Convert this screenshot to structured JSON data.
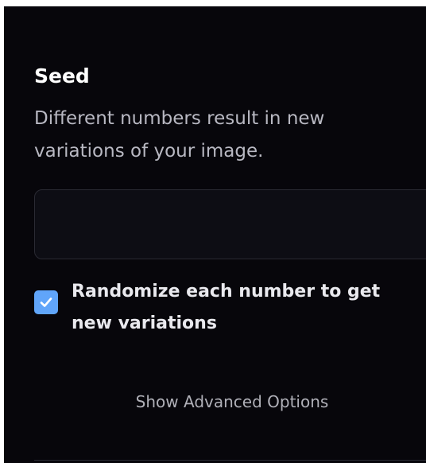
{
  "seed": {
    "title": "Seed",
    "description": "Different numbers result in new variations of your image.",
    "input_value": "",
    "input_placeholder": ""
  },
  "randomize": {
    "checked": true,
    "label": "Randomize each number to get new variations"
  },
  "advanced": {
    "label": "Show Advanced Options"
  },
  "colors": {
    "panel_background": "#07060b",
    "checkbox_accent": "#60a5fa",
    "title_text": "#ffffff",
    "muted_text": "#b8b8c2"
  },
  "icons": {
    "checkbox": "checkmark-icon"
  }
}
